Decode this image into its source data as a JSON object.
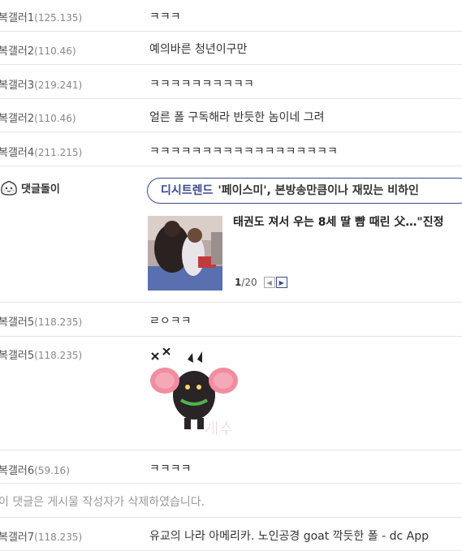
{
  "comments": [
    {
      "nick": "복갤러1",
      "ip": "(125.135)",
      "text": "ㅋㅋㅋ"
    },
    {
      "nick": "복갤러2",
      "ip": "(110.46)",
      "text": "예의바른 청년이구만"
    },
    {
      "nick": "복갤러3",
      "ip": "(219.241)",
      "text": "ㅋㅋㅋㅋㅋㅋㅋㅋㅋㅋ"
    },
    {
      "nick": "복갤러2",
      "ip": "(110.46)",
      "text": "얼른 폴 구독해라 반듯한 놈이네 그려"
    },
    {
      "nick": "복갤러4",
      "ip": "(211.215)",
      "text": "ㅋㅋㅋㅋㅋㅋㅋㅋㅋㅋㅋㅋㅋㅋㅋㅋㅋㅋ"
    }
  ],
  "bot": {
    "name": "댓글돌이",
    "source": "디시트렌드",
    "headline": "'페이스미', 본방송만큼이나 재밌는 비하인",
    "news_title": "태권도 져서 우는 8세 딸 뺨 때린 父…\"진정",
    "page_current": "1",
    "page_total": "/20"
  },
  "comments2": [
    {
      "nick": "복갤러5",
      "ip": "(118.235)",
      "text": "ㄹㅇㅋㅋ"
    },
    {
      "nick": "복갤러5",
      "ip": "(118.235)",
      "sticker_text": "개추"
    },
    {
      "nick": "복갤러6",
      "ip": "(59.16)",
      "text": "ㅋㅋㅋㅋ"
    }
  ],
  "deleted_notice": "이 댓글은 게시물 작성자가 삭제하였습니다.",
  "last": {
    "nick": "복갤러7",
    "ip": "(118.235)",
    "text": "유교의 나라 아메리카. 노인공경 goat 깍듯한 폴 - dc App"
  }
}
